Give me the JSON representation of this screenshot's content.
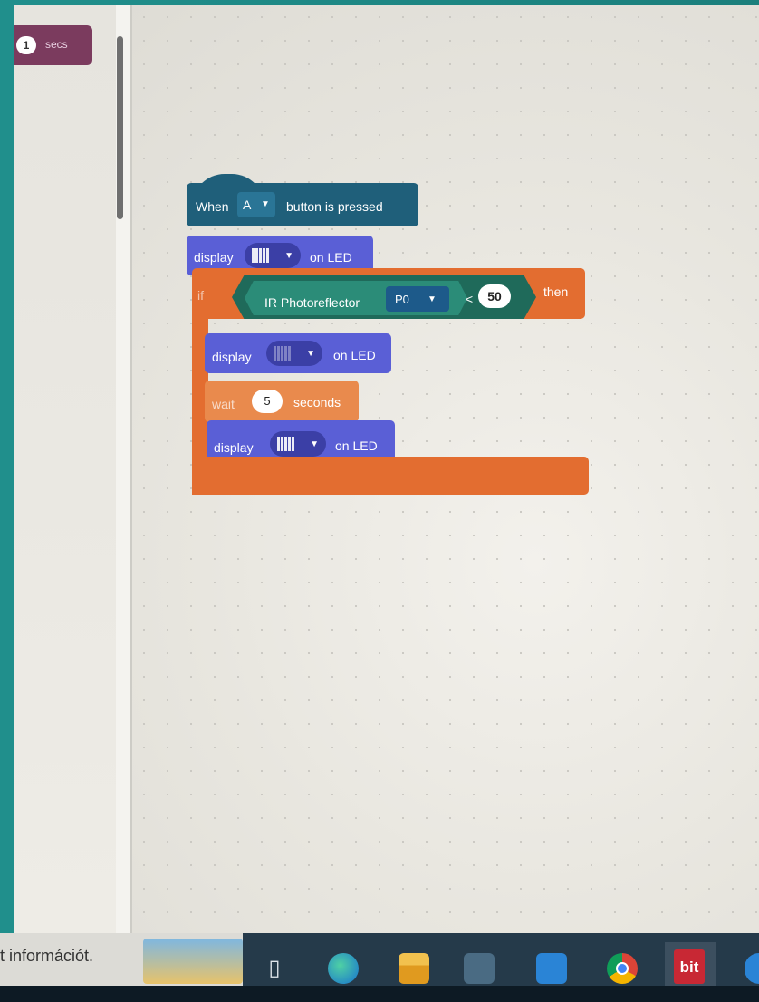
{
  "palette": {
    "wait_number": "1",
    "wait_unit": "secs"
  },
  "program": {
    "hat": {
      "prefix": "When",
      "button_value": "A",
      "suffix": "button is pressed"
    },
    "display1": {
      "label": "display",
      "suffix": "on LED"
    },
    "if_block": {
      "keyword": "if",
      "sensor_label": "IR Photoreflector",
      "pin_value": "P0",
      "operator": "<",
      "threshold": "50",
      "then_label": "then"
    },
    "display2": {
      "label": "display",
      "suffix": "on LED"
    },
    "wait": {
      "label": "wait",
      "value": "5",
      "unit": "seconds"
    },
    "display3": {
      "label": "display",
      "suffix": "on LED"
    }
  },
  "taskbar": {
    "info_text": "t információt.",
    "icons": [
      "task-view-icon",
      "edge-icon",
      "file-explorer-icon",
      "store-icon",
      "mail-icon",
      "chrome-icon",
      "bit-app-icon"
    ],
    "bit_label": "bit"
  },
  "colors": {
    "hat": "#1f5f7a",
    "display": "#5a5fd6",
    "control": "#e36d30",
    "sensor": "#1f6a5a",
    "palette_wait": "#7b3b5e"
  }
}
